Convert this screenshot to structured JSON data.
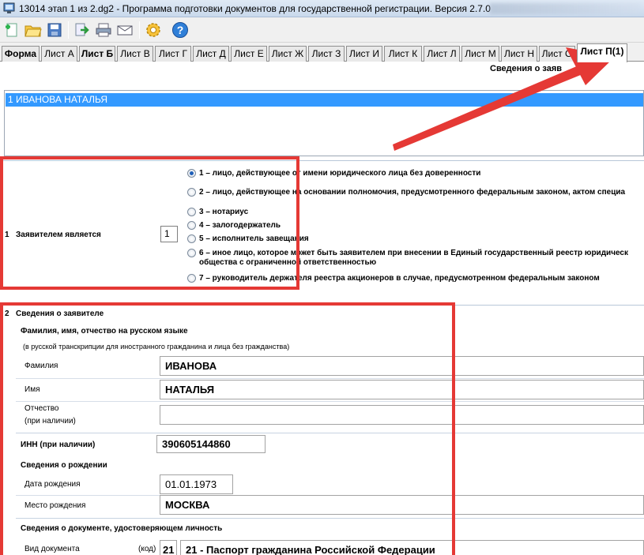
{
  "window": {
    "title": "13014 этап 1 из 2.dg2 - Программа подготовки документов для государственной регистрации. Версия 2.7.0"
  },
  "toolbar": {
    "buttons": [
      "new-icon",
      "open-folder-icon",
      "save-icon",
      "export-icon",
      "print-icon",
      "mail-icon",
      "settings-gear-icon",
      "help-icon"
    ]
  },
  "tabs": [
    {
      "label": "Форма",
      "bold": true
    },
    {
      "label": "Лист А"
    },
    {
      "label": "Лист Б",
      "bold": true
    },
    {
      "label": "Лист В"
    },
    {
      "label": "Лист Г"
    },
    {
      "label": "Лист Д"
    },
    {
      "label": "Лист Е"
    },
    {
      "label": "Лист Ж"
    },
    {
      "label": "Лист З"
    },
    {
      "label": "Лист И"
    },
    {
      "label": "Лист К"
    },
    {
      "label": "Лист Л"
    },
    {
      "label": "Лист М"
    },
    {
      "label": "Лист Н"
    },
    {
      "label": "Лист О"
    },
    {
      "label": "Лист П(1)",
      "active": true
    }
  ],
  "header": {
    "caption": "Сведения о заяв"
  },
  "applicant_list": {
    "selected_item": "1 ИВАНОВА НАТАЛЬЯ"
  },
  "section1": {
    "number": "1",
    "label": "Заявителем является",
    "value": "1",
    "options": [
      {
        "text": "1 – лицо, действующее от имени юридического лица без доверенности",
        "checked": true
      },
      {
        "text": "2 – лицо, действующее на основании полномочия, предусмотренного федеральным законом, актом специа"
      },
      {
        "text": "3 – нотариус"
      },
      {
        "text": "4 – залогодержатель"
      },
      {
        "text": "5 – исполнитель завещания"
      },
      {
        "text": "6 – иное лицо, которое может быть заявителем при внесении в Единый государственный реестр юридическ",
        "text2": "общества с ограниченной ответственностью"
      },
      {
        "text": "7 – руководитель держателя реестра акционеров в случае, предусмотренном федеральным законом"
      }
    ]
  },
  "section2": {
    "number": "2",
    "title": "Сведения о заявителе",
    "fio_heading": "Фамилия, имя, отчество на русском языке",
    "fio_note": "(в русской транскрипции для иностранного гражданина и лица без гражданства)",
    "surname_label": "Фамилия",
    "surname_value": "ИВАНОВА",
    "name_label": "Имя",
    "name_value": "НАТАЛЬЯ",
    "patronymic_label_1": "Отчество",
    "patronymic_label_2": "(при наличии)",
    "patronymic_value": "",
    "inn_label": "ИНН (при наличии)",
    "inn_value": "390605144860",
    "birth_heading": "Сведения о рождении",
    "birth_date_label": "Дата рождения",
    "birth_date_value": "01.01.1973",
    "birth_place_label": "Место рождения",
    "birth_place_value": "МОСКВА",
    "doc_heading": "Сведения о документе, удостоверяющем личность",
    "doc_type_label": "Вид документа",
    "doc_code_label": "(код)",
    "doc_code_value": "21",
    "doc_type_value": "21 - Паспорт гражданина Российской Федерации"
  },
  "annotation_color": "#e53935"
}
